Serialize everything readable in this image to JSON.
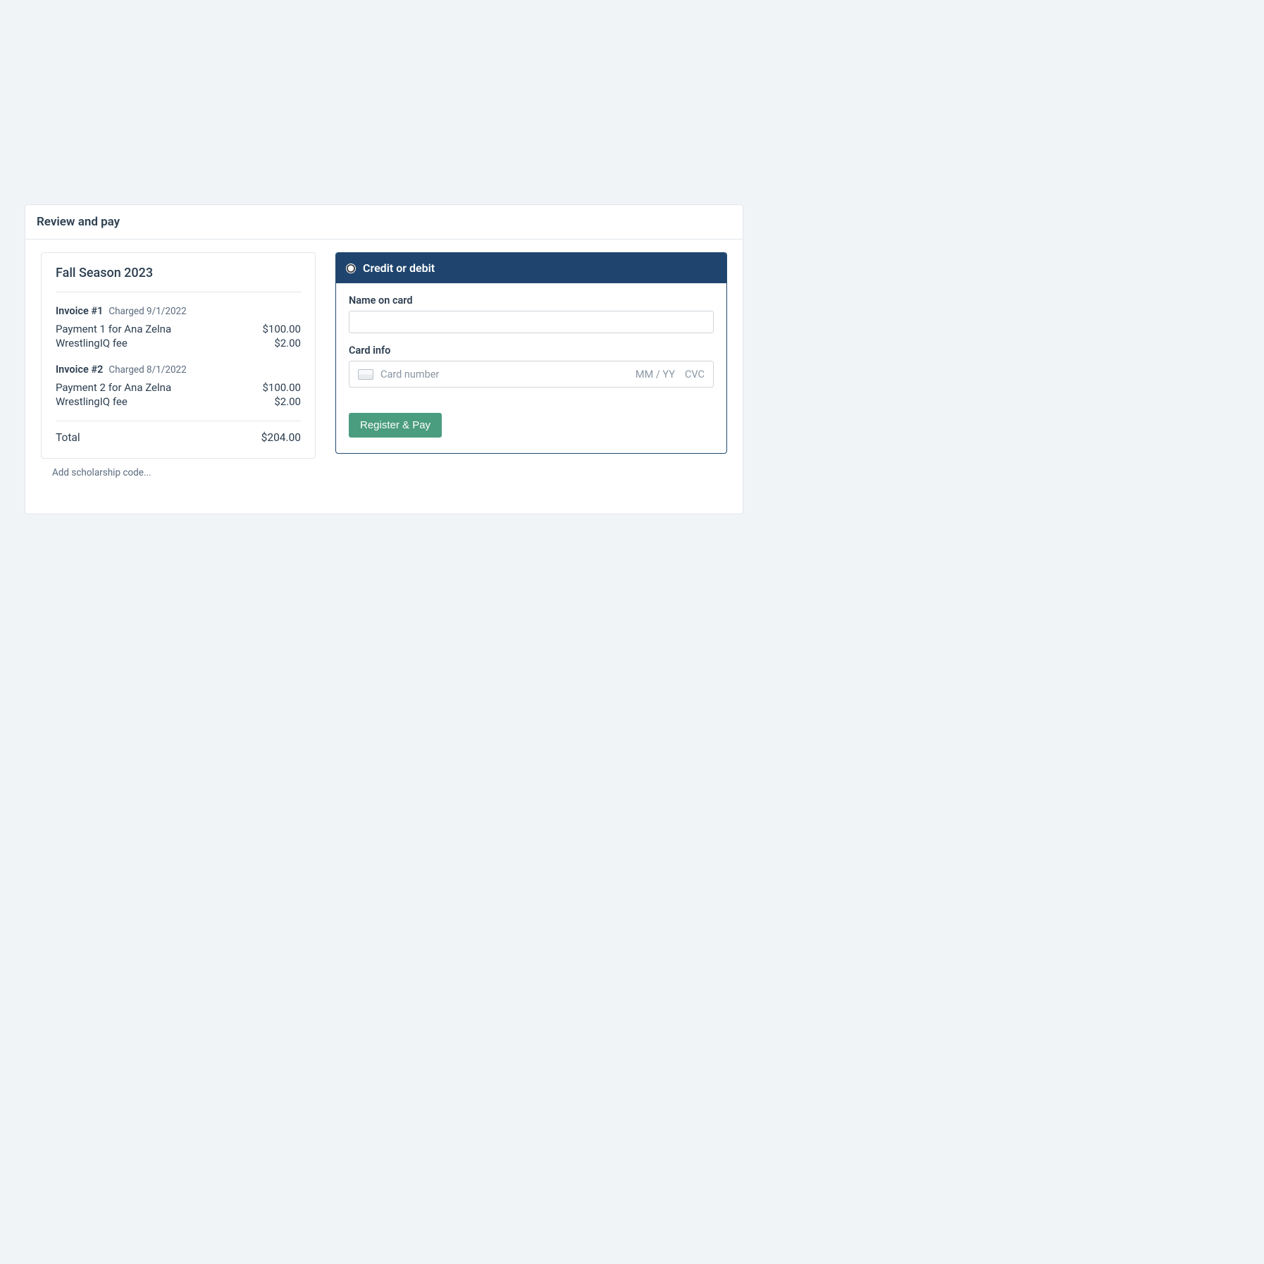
{
  "page_title": "Review and pay",
  "season_title": "Fall Season 2023",
  "invoices": [
    {
      "title": "Invoice #1",
      "charged": "Charged 9/1/2022",
      "lines": [
        {
          "label": "Payment 1 for Ana Zelna",
          "amount": "$100.00"
        },
        {
          "label": "WrestlingIQ fee",
          "amount": "$2.00"
        }
      ]
    },
    {
      "title": "Invoice #2",
      "charged": "Charged 8/1/2022",
      "lines": [
        {
          "label": "Payment 2 for Ana Zelna",
          "amount": "$100.00"
        },
        {
          "label": "WrestlingIQ fee",
          "amount": "$2.00"
        }
      ]
    }
  ],
  "total_label": "Total",
  "total_amount": "$204.00",
  "scholarship_link": "Add scholarship code...",
  "payment": {
    "header_label": "Credit or debit",
    "name_label": "Name on card",
    "card_info_label": "Card info",
    "card_number_placeholder": "Card number",
    "card_exp_placeholder": "MM / YY",
    "card_cvc_placeholder": "CVC",
    "submit_label": "Register & Pay"
  }
}
